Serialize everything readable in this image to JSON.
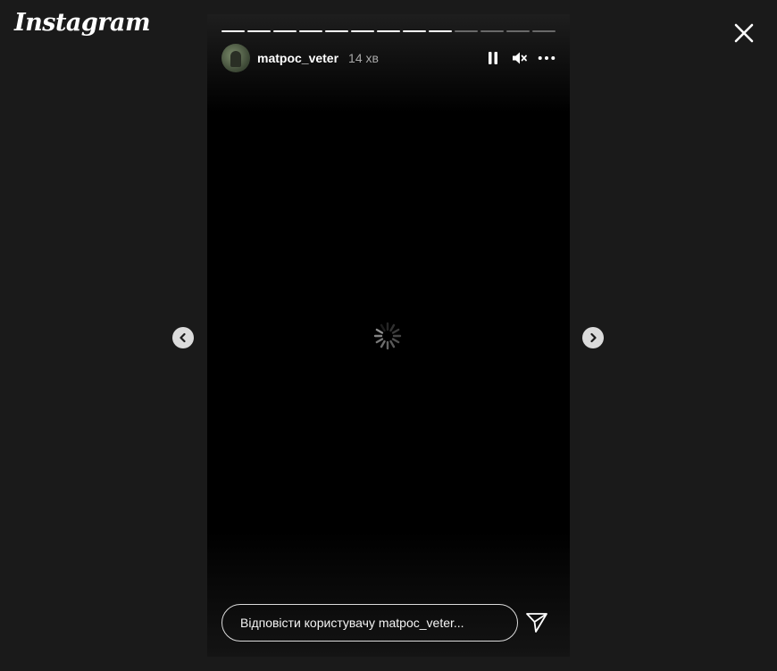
{
  "app": {
    "logo_text": "Instagram"
  },
  "story": {
    "username": "matpoc_veter",
    "time_ago": "14 хв",
    "segments_total": 13,
    "segments_done": 9,
    "reply_placeholder": "Відповісти користувачу matpoc_veter..."
  },
  "icons": {
    "close": "close-icon",
    "pause": "pause-icon",
    "mute": "muted-speaker-icon",
    "more": "more-options-icon",
    "prev": "chevron-left-icon",
    "next": "chevron-right-icon",
    "send": "send-icon",
    "loading": "loading-spinner-icon"
  },
  "colors": {
    "background": "#1a1a1a",
    "story_bg": "#000000",
    "nav_button": "#dbdbdb"
  }
}
